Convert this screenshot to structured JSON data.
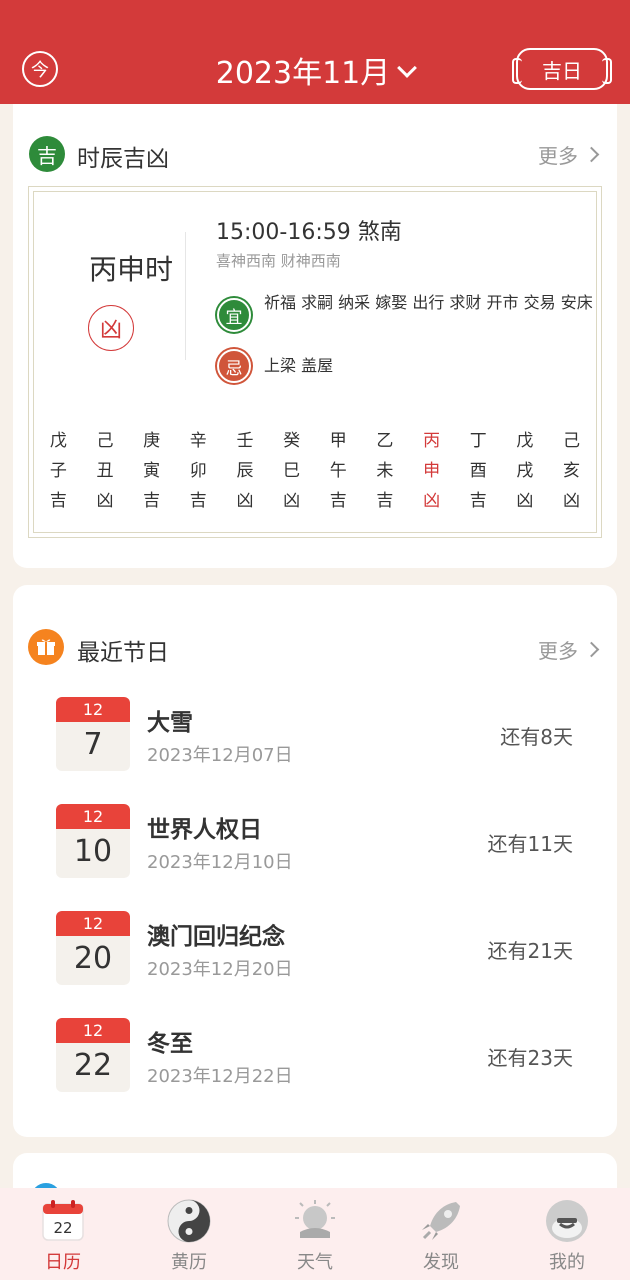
{
  "header": {
    "today_label": "今",
    "month_title": "2023年11月",
    "jiri_label": "吉日"
  },
  "shichen": {
    "section_icon_label": "吉",
    "title": "时辰吉凶",
    "more_label": "更多",
    "current_name": "丙申时",
    "current_luck": "凶",
    "time_range": "15:00-16:59 煞南",
    "gods": "喜神西南 财神西南",
    "yi_label": "宜",
    "yi_text": "祈福 求嗣 纳采 嫁娶 出行 求财 开市 交易 安床",
    "ji_label": "忌",
    "ji_text": "上梁 盖屋",
    "hours": [
      {
        "stem": "戊",
        "branch": "子",
        "luck": "吉",
        "current": false
      },
      {
        "stem": "己",
        "branch": "丑",
        "luck": "凶",
        "current": false
      },
      {
        "stem": "庚",
        "branch": "寅",
        "luck": "吉",
        "current": false
      },
      {
        "stem": "辛",
        "branch": "卯",
        "luck": "吉",
        "current": false
      },
      {
        "stem": "壬",
        "branch": "辰",
        "luck": "凶",
        "current": false
      },
      {
        "stem": "癸",
        "branch": "巳",
        "luck": "凶",
        "current": false
      },
      {
        "stem": "甲",
        "branch": "午",
        "luck": "吉",
        "current": false
      },
      {
        "stem": "乙",
        "branch": "未",
        "luck": "吉",
        "current": false
      },
      {
        "stem": "丙",
        "branch": "申",
        "luck": "凶",
        "current": true
      },
      {
        "stem": "丁",
        "branch": "酉",
        "luck": "吉",
        "current": false
      },
      {
        "stem": "戊",
        "branch": "戌",
        "luck": "凶",
        "current": false
      },
      {
        "stem": "己",
        "branch": "亥",
        "luck": "凶",
        "current": false
      }
    ]
  },
  "festivals": {
    "title": "最近节日",
    "more_label": "更多",
    "items": [
      {
        "month": "12",
        "day": "7",
        "name": "大雪",
        "date": "2023年12月07日",
        "remain": "还有8天"
      },
      {
        "month": "12",
        "day": "10",
        "name": "世界人权日",
        "date": "2023年12月10日",
        "remain": "还有11天"
      },
      {
        "month": "12",
        "day": "20",
        "name": "澳门回归纪念",
        "date": "2023年12月20日",
        "remain": "还有21天"
      },
      {
        "month": "12",
        "day": "22",
        "name": "冬至",
        "date": "2023年12月22日",
        "remain": "还有23天"
      }
    ]
  },
  "tabbar": {
    "calendar_day": "22",
    "tabs": [
      {
        "label": "日历",
        "icon": "calendar-icon",
        "active": true
      },
      {
        "label": "黄历",
        "icon": "yin-yang-icon",
        "active": false
      },
      {
        "label": "天气",
        "icon": "weather-icon",
        "active": false
      },
      {
        "label": "发现",
        "icon": "rocket-icon",
        "active": false
      },
      {
        "label": "我的",
        "icon": "profile-icon",
        "active": false
      }
    ]
  },
  "colors": {
    "brand_red": "#d33a3a",
    "yi_green": "#2e8b3a",
    "ji_orange": "#d0553a",
    "festival_orange": "#f5831f"
  }
}
